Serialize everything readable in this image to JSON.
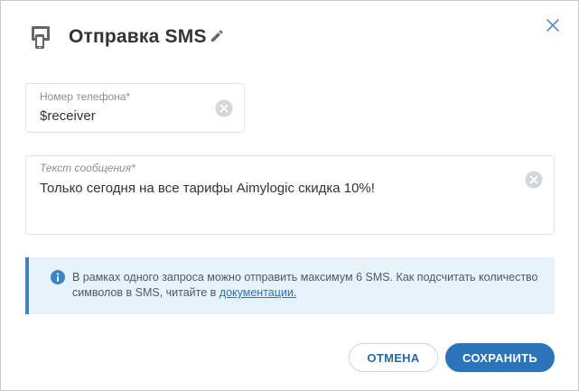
{
  "dialog": {
    "title": "Отправка SMS",
    "title_icon": "phone-chat-icon",
    "edit_icon": "pencil-icon",
    "close_icon": "close-icon"
  },
  "phone_field": {
    "label": "Номер телефона*",
    "value": "$receiver",
    "clear_icon": "clear-circle-icon"
  },
  "message_field": {
    "label": "Текст сообщения*",
    "value": "Только сегодня на все тарифы Aimylogic скидка 10%!",
    "clear_icon": "clear-circle-icon"
  },
  "notice": {
    "icon": "info-icon",
    "text": "В рамках одного запроса можно отправить максимум 6 SMS. Как подсчитать количество символов в SMS, читайте в ",
    "link_text": "документации.",
    "accent_color": "#3a85c5",
    "background_color": "#e8f2fb"
  },
  "buttons": {
    "cancel": "ОТМЕНА",
    "save": "СОХРАНИТЬ",
    "primary_color": "#2b74ba"
  }
}
